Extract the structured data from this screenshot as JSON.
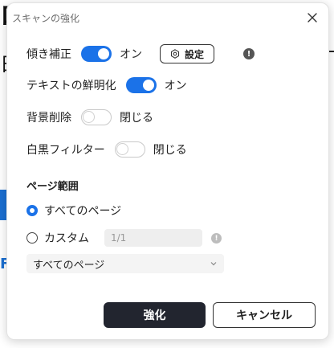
{
  "background": {
    "text1": "ロ",
    "text2": "日",
    "letter": "F"
  },
  "dialog": {
    "title": "スキャンの強化",
    "close_icon": "close-icon"
  },
  "options": {
    "skew": {
      "label": "傾き補正",
      "enabled": true,
      "state": "オン",
      "settings_label": "設定"
    },
    "sharpen": {
      "label": "テキストの鮮明化",
      "enabled": true,
      "state": "オン"
    },
    "bg_removal": {
      "label": "背景削除",
      "enabled": false,
      "state": "閉じる"
    },
    "bw_filter": {
      "label": "白黒フィルター",
      "enabled": false,
      "state": "閉じる"
    }
  },
  "page_range": {
    "title": "ページ範囲",
    "all_pages_label": "すべてのページ",
    "custom_label": "カスタム",
    "selected": "all",
    "custom_placeholder": "1/1",
    "select_value": "すべてのページ"
  },
  "buttons": {
    "enhance": "強化",
    "cancel": "キャンセル"
  },
  "colors": {
    "accent": "#1b72e8",
    "primary_button": "#22252f"
  }
}
